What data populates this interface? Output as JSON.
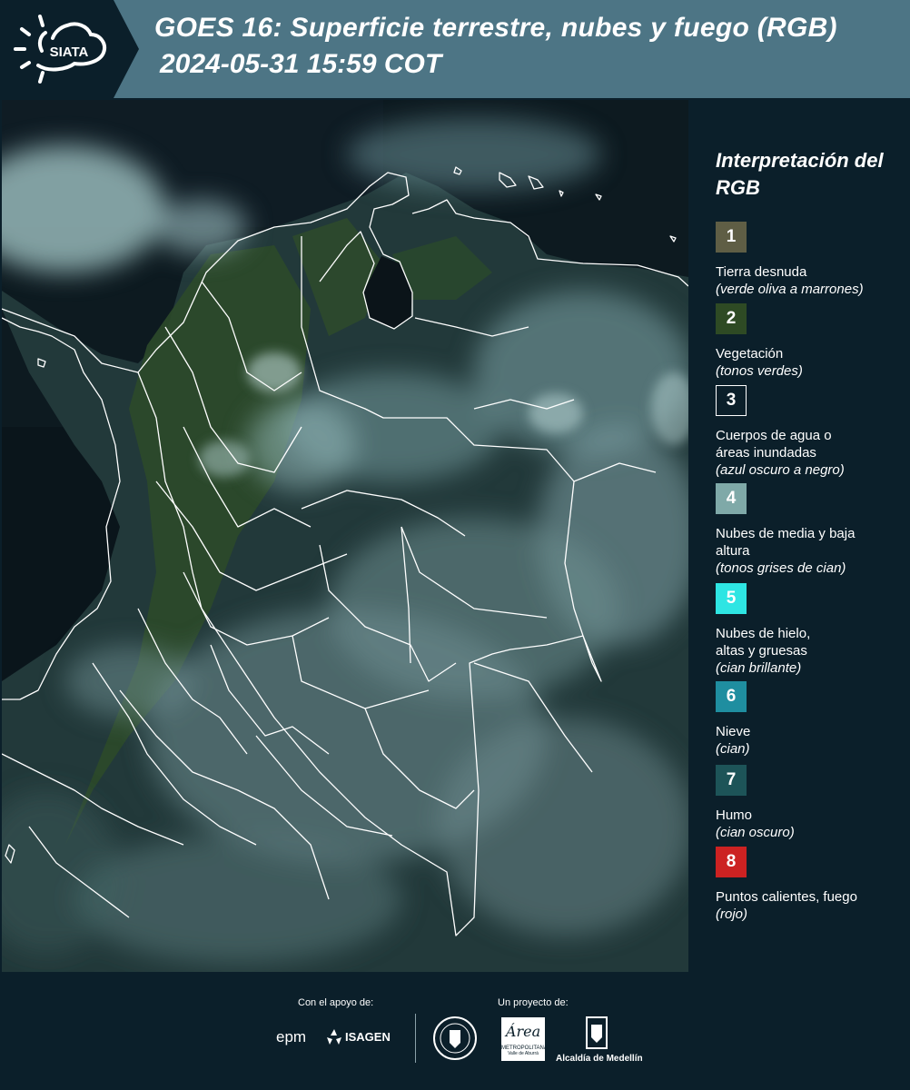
{
  "header": {
    "logo_text": "SIATA",
    "title_line1": "GOES 16: Superficie terrestre, nubes y fuego (RGB)",
    "title_line2": "2024-05-31 15:59 COT"
  },
  "colors": {
    "header_dark": "#0b1f2a",
    "header_band": "#4d7585",
    "ocean": "#0d1a20",
    "land_green": "#2c4a30",
    "cloud_cyan": "#86a8ae",
    "border_white": "#ffffff"
  },
  "legend": {
    "title": "Interpretación del RGB",
    "items": [
      {
        "num": "1",
        "color": "#5f5e45",
        "label": "Tierra desnuda",
        "sub": "(verde oliva a marrones)"
      },
      {
        "num": "2",
        "color": "#2e4a24",
        "label": "Vegetación",
        "sub": "(tonos verdes)"
      },
      {
        "num": "3",
        "color": "#0b1f2a",
        "label": "Cuerpos de agua o áreas inundadas",
        "sub": "(azul oscuro a negro)"
      },
      {
        "num": "4",
        "color": "#7fa9a8",
        "label": "Nubes de media y baja altura",
        "sub": "(tonos grises de cian)"
      },
      {
        "num": "5",
        "color": "#2ee5e3",
        "label": "Nubes de hielo, altas y gruesas",
        "sub": "(cian brillante)"
      },
      {
        "num": "6",
        "color": "#1f8ea0",
        "label": "Nieve",
        "sub": "(cian)"
      },
      {
        "num": "7",
        "color": "#1d5458",
        "label": "Humo",
        "sub": "(cian oscuro)"
      },
      {
        "num": "8",
        "color": "#cc2222",
        "label": "Puntos calientes, fuego",
        "sub": "(rojo)"
      }
    ]
  },
  "footer": {
    "support_label": "Con el apoyo de:",
    "project_label": "Un proyecto de:",
    "epm": "epm",
    "isagen": "ISAGEN",
    "metro_line1": "METROPOLITANA",
    "metro_line2": "Valle de Aburrá",
    "area_script": "Área",
    "medellin": "Alcaldía de Medellín"
  }
}
